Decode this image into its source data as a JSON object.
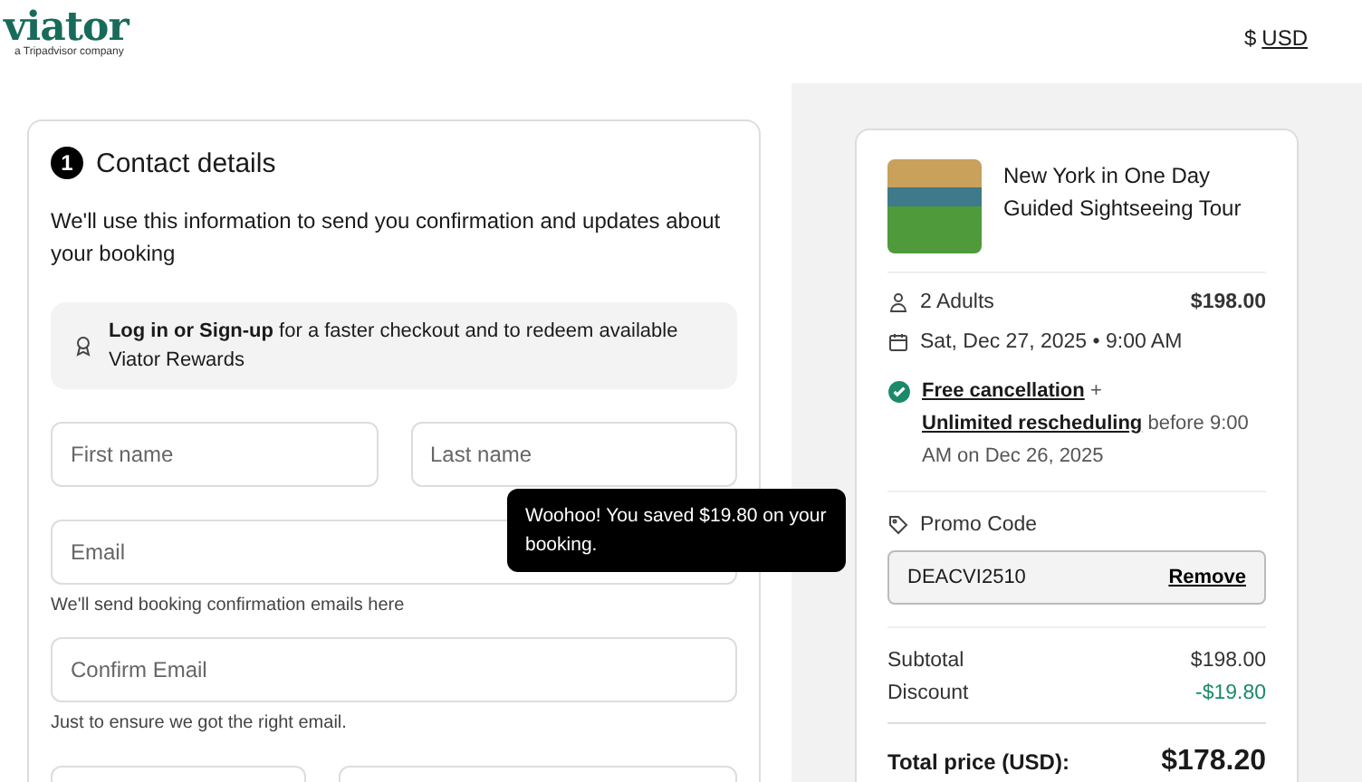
{
  "header": {
    "logo": "viator",
    "logo_tagline": "a Tripadvisor company",
    "currency_symbol": "$",
    "currency": "USD"
  },
  "contact": {
    "step": "1",
    "title": "Contact details",
    "intro": "We'll use this information to send you confirmation and updates about your booking",
    "login_banner": "**Log in or Sign-up** for a faster checkout and to redeem available Viator Rewards",
    "fields": [
      {
        "placeholder": "First name"
      },
      {
        "placeholder": "Last name"
      }
    ],
    "email": {
      "placeholder": "Email",
      "hint": "We'll send booking confirmation emails here"
    },
    "confirm_email": {
      "placeholder": "Confirm Email",
      "hint": "Just to ensure we got the right email."
    }
  },
  "tooltip": {
    "text": "Woohoo! You saved $19.80 on your booking."
  },
  "summary": {
    "tour_title": "New York in One Day Guided Sightseeing Tour",
    "travelers": "2 Adults",
    "price": "$198.00",
    "date": "Sat, Dec 27, 2025 • 9:00 AM",
    "cancellation_link": "Free cancellation",
    "cancellation_plus": "+",
    "rescheduling_link": "Unlimited rescheduling",
    "policy_deadline": "before 9:00 AM on Dec 26, 2025",
    "promo_label": "Promo Code",
    "promo_code": "DEACVI2510",
    "promo_remove": "Remove",
    "lines": [
      {
        "label": "Subtotal",
        "value": "$198.00",
        "kind": "plain"
      },
      {
        "label": "Discount",
        "value": "-$19.80",
        "kind": "discount"
      }
    ],
    "total_label": "Total price (USD):",
    "total_value": "$178.20"
  }
}
